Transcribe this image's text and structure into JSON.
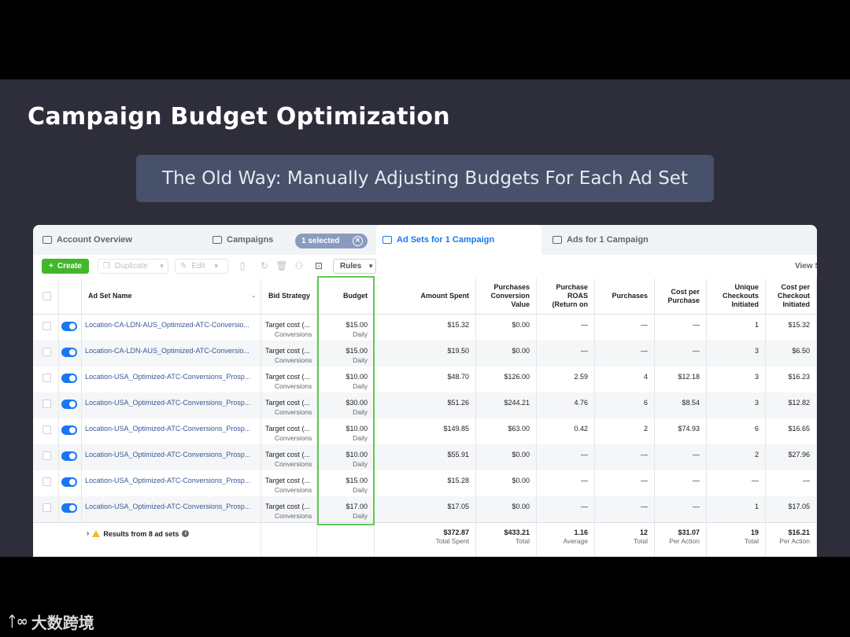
{
  "slide": {
    "title": "Campaign Budget Optimization",
    "subtitle": "The Old Way: Manually Adjusting Budgets For Each Ad Set"
  },
  "tabs": {
    "account_overview": "Account Overview",
    "campaigns": "Campaigns",
    "selected_pill": "1 selected",
    "ad_sets": "Ad Sets for 1 Campaign",
    "ads": "Ads for 1 Campaign"
  },
  "toolbar": {
    "create": "Create",
    "duplicate": "Duplicate",
    "edit": "Edit",
    "rules": "Rules",
    "view": "View S"
  },
  "columns": {
    "ad_set_name": "Ad Set Name",
    "bid_strategy": "Bid Strategy",
    "budget": "Budget",
    "amount_spent": "Amount Spent",
    "purchases_conversion_value": "Purchases Conversion Value",
    "purchase_roas": "Purchase ROAS (Return on",
    "purchases": "Purchases",
    "cost_per_purchase": "Cost per Purchase",
    "unique_checkouts": "Unique Checkouts Initiated",
    "cost_per_checkout": "Cost per Checkout Initiated"
  },
  "rows": [
    {
      "name": "Location-CA-LDN-AUS_Optimized-ATC-Conversio...",
      "bid": "Target cost (...",
      "bid_sub": "Conversions",
      "budget": "$15.00",
      "budget_sub": "Daily",
      "spent": "$15.32",
      "conv_value": "$0.00",
      "roas": "—",
      "purchases": "—",
      "cpp": "—",
      "checkouts": "1",
      "cpc": "$15.32"
    },
    {
      "name": "Location-CA-LDN-AUS_Optimized-ATC-Conversio...",
      "bid": "Target cost (...",
      "bid_sub": "Conversions",
      "budget": "$15.00",
      "budget_sub": "Daily",
      "spent": "$19.50",
      "conv_value": "$0.00",
      "roas": "—",
      "purchases": "—",
      "cpp": "—",
      "checkouts": "3",
      "cpc": "$6.50"
    },
    {
      "name": "Location-USA_Optimized-ATC-Conversions_Prosp...",
      "bid": "Target cost (...",
      "bid_sub": "Conversions",
      "budget": "$10.00",
      "budget_sub": "Daily",
      "spent": "$48.70",
      "conv_value": "$126.00",
      "roas": "2.59",
      "purchases": "4",
      "cpp": "$12.18",
      "checkouts": "3",
      "cpc": "$16.23"
    },
    {
      "name": "Location-USA_Optimized-ATC-Conversions_Prosp...",
      "bid": "Target cost (...",
      "bid_sub": "Conversions",
      "budget": "$30.00",
      "budget_sub": "Daily",
      "spent": "$51.26",
      "conv_value": "$244.21",
      "roas": "4.76",
      "purchases": "6",
      "cpp": "$8.54",
      "checkouts": "3",
      "cpc": "$12.82"
    },
    {
      "name": "Location-USA_Optimized-ATC-Conversions_Prosp...",
      "bid": "Target cost (...",
      "bid_sub": "Conversions",
      "budget": "$10.00",
      "budget_sub": "Daily",
      "spent": "$149.85",
      "conv_value": "$63.00",
      "roas": "0.42",
      "purchases": "2",
      "cpp": "$74.93",
      "checkouts": "6",
      "cpc": "$16.65"
    },
    {
      "name": "Location-USA_Optimized-ATC-Conversions_Prosp...",
      "bid": "Target cost (...",
      "bid_sub": "Conversions",
      "budget": "$10.00",
      "budget_sub": "Daily",
      "spent": "$55.91",
      "conv_value": "$0.00",
      "roas": "—",
      "purchases": "—",
      "cpp": "—",
      "checkouts": "2",
      "cpc": "$27.96"
    },
    {
      "name": "Location-USA_Optimized-ATC-Conversions_Prosp...",
      "bid": "Target cost (...",
      "bid_sub": "Conversions",
      "budget": "$15.00",
      "budget_sub": "Daily",
      "spent": "$15.28",
      "conv_value": "$0.00",
      "roas": "—",
      "purchases": "—",
      "cpp": "—",
      "checkouts": "—",
      "cpc": "—"
    },
    {
      "name": "Location-USA_Optimized-ATC-Conversions_Prosp...",
      "bid": "Target cost (...",
      "bid_sub": "Conversions",
      "budget": "$17.00",
      "budget_sub": "Daily",
      "spent": "$17.05",
      "conv_value": "$0.00",
      "roas": "—",
      "purchases": "—",
      "cpp": "—",
      "checkouts": "1",
      "cpc": "$17.05"
    }
  ],
  "totals": {
    "label": "Results from 8 ad sets",
    "spent": "$372.87",
    "spent_sub": "Total Spent",
    "conv_value": "$433.21",
    "conv_value_sub": "Total",
    "roas": "1.16",
    "roas_sub": "Average",
    "purchases": "12",
    "purchases_sub": "Total",
    "cpp": "$31.07",
    "cpp_sub": "Per Action",
    "checkouts": "19",
    "checkouts_sub": "Total",
    "cpc": "$16.21",
    "cpc_sub": "Per Action"
  },
  "watermark": "大数跨境",
  "colors": {
    "slide_bg": "#2d2e3a",
    "subtitle_bg": "#48516a",
    "accent_blue": "#1877f2",
    "create_green": "#42b72a",
    "highlight_green": "#5ecb52"
  }
}
